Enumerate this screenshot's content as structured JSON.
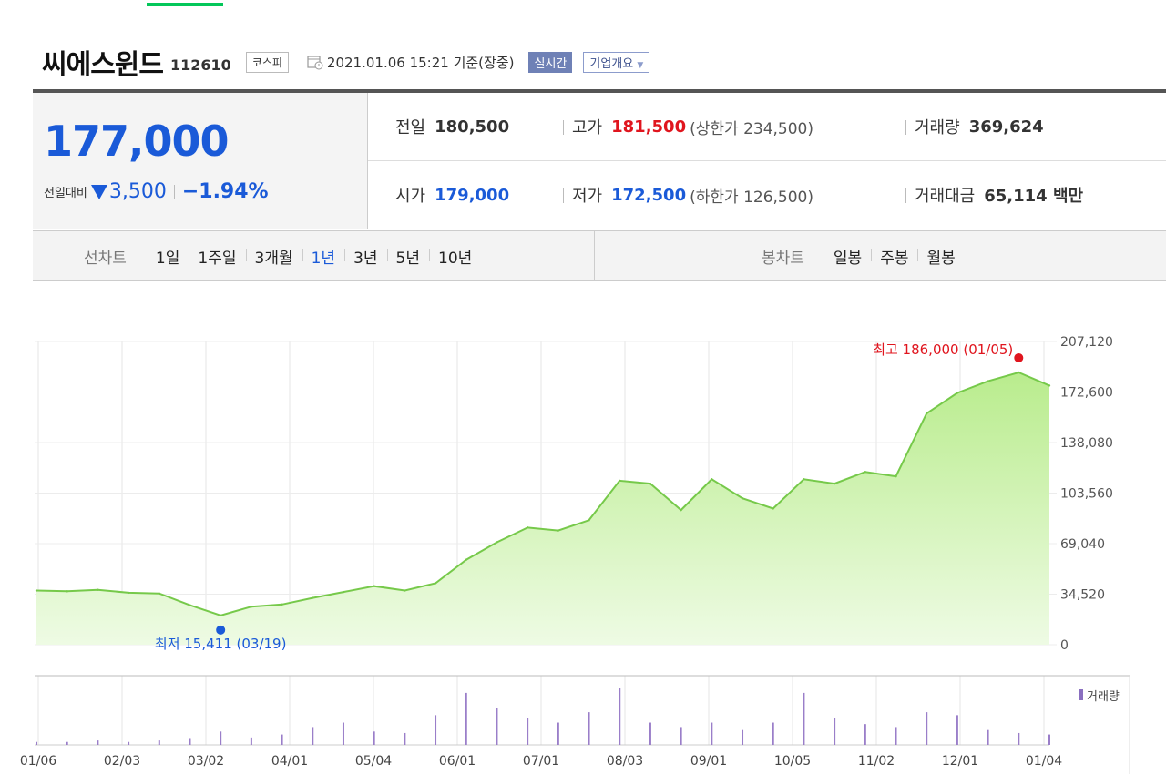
{
  "stock": {
    "name": "씨에스윈드",
    "code": "112610",
    "market": "코스피",
    "datetime": "2021.01.06 15:21 기준(장중)",
    "realtime_label": "실시간",
    "overview_label": "기업개요"
  },
  "quote": {
    "price": "177,000",
    "change_label": "전일대비",
    "change": "3,500",
    "change_pct": "−1.94%",
    "direction": "down"
  },
  "stats": {
    "prev_label": "전일",
    "prev": "180,500",
    "high_label": "고가",
    "high": "181,500",
    "upper_limit": "(상한가 234,500)",
    "volume_label": "거래량",
    "volume": "369,624",
    "open_label": "시가",
    "open": "179,000",
    "low_label": "저가",
    "low": "172,500",
    "lower_limit": "(하한가 126,500)",
    "amount_label": "거래대금",
    "amount": "65,114 백만"
  },
  "line_periods": {
    "label": "선차트",
    "items": [
      "1일",
      "1주일",
      "3개월",
      "1년",
      "3년",
      "5년",
      "10년"
    ],
    "active": "1년"
  },
  "candle_periods": {
    "label": "봉차트",
    "items": [
      "일봉",
      "주봉",
      "월봉"
    ]
  },
  "colors": {
    "up": "#e0151e",
    "down": "#1a5ad8",
    "line": "#76c94a",
    "fill": "#b9ec8d"
  },
  "chart_data": {
    "type": "area",
    "x_ticks": [
      "01/06",
      "02/03",
      "03/02",
      "04/01",
      "05/04",
      "06/01",
      "07/01",
      "08/03",
      "09/01",
      "10/05",
      "11/02",
      "12/01",
      "01/04"
    ],
    "y_ticks": [
      "207,120",
      "172,600",
      "138,080",
      "103,560",
      "69,040",
      "34,520",
      "0"
    ],
    "ylim": [
      0,
      207120
    ],
    "max_annotation": "최고 186,000 (01/05)",
    "min_annotation": "최저 15,411 (03/19)",
    "volume_legend": "거래량",
    "x": [
      "01/06",
      "01/20",
      "02/03",
      "02/17",
      "03/02",
      "03/10",
      "03/19",
      "04/01",
      "04/15",
      "05/04",
      "05/20",
      "06/01",
      "06/15",
      "07/01",
      "07/10",
      "07/20",
      "08/03",
      "08/15",
      "08/24",
      "09/01",
      "09/10",
      "09/20",
      "10/05",
      "10/10",
      "10/20",
      "11/02",
      "11/05",
      "11/15",
      "12/01",
      "12/10",
      "12/20",
      "01/04",
      "01/05",
      "01/06"
    ],
    "values": [
      37000,
      36500,
      37500,
      35500,
      35000,
      27000,
      20000,
      26000,
      27500,
      32000,
      36000,
      40000,
      37000,
      42000,
      58000,
      70000,
      80000,
      78000,
      85000,
      112000,
      110000,
      92000,
      113000,
      100000,
      93000,
      113000,
      110000,
      118000,
      115000,
      158000,
      172000,
      180000,
      186000,
      177000
    ],
    "volume": [
      2,
      2,
      3,
      2,
      3,
      4,
      9,
      5,
      7,
      12,
      15,
      9,
      8,
      20,
      35,
      25,
      18,
      15,
      22,
      38,
      15,
      12,
      15,
      10,
      15,
      35,
      18,
      14,
      12,
      22,
      20,
      10,
      8,
      7
    ]
  }
}
